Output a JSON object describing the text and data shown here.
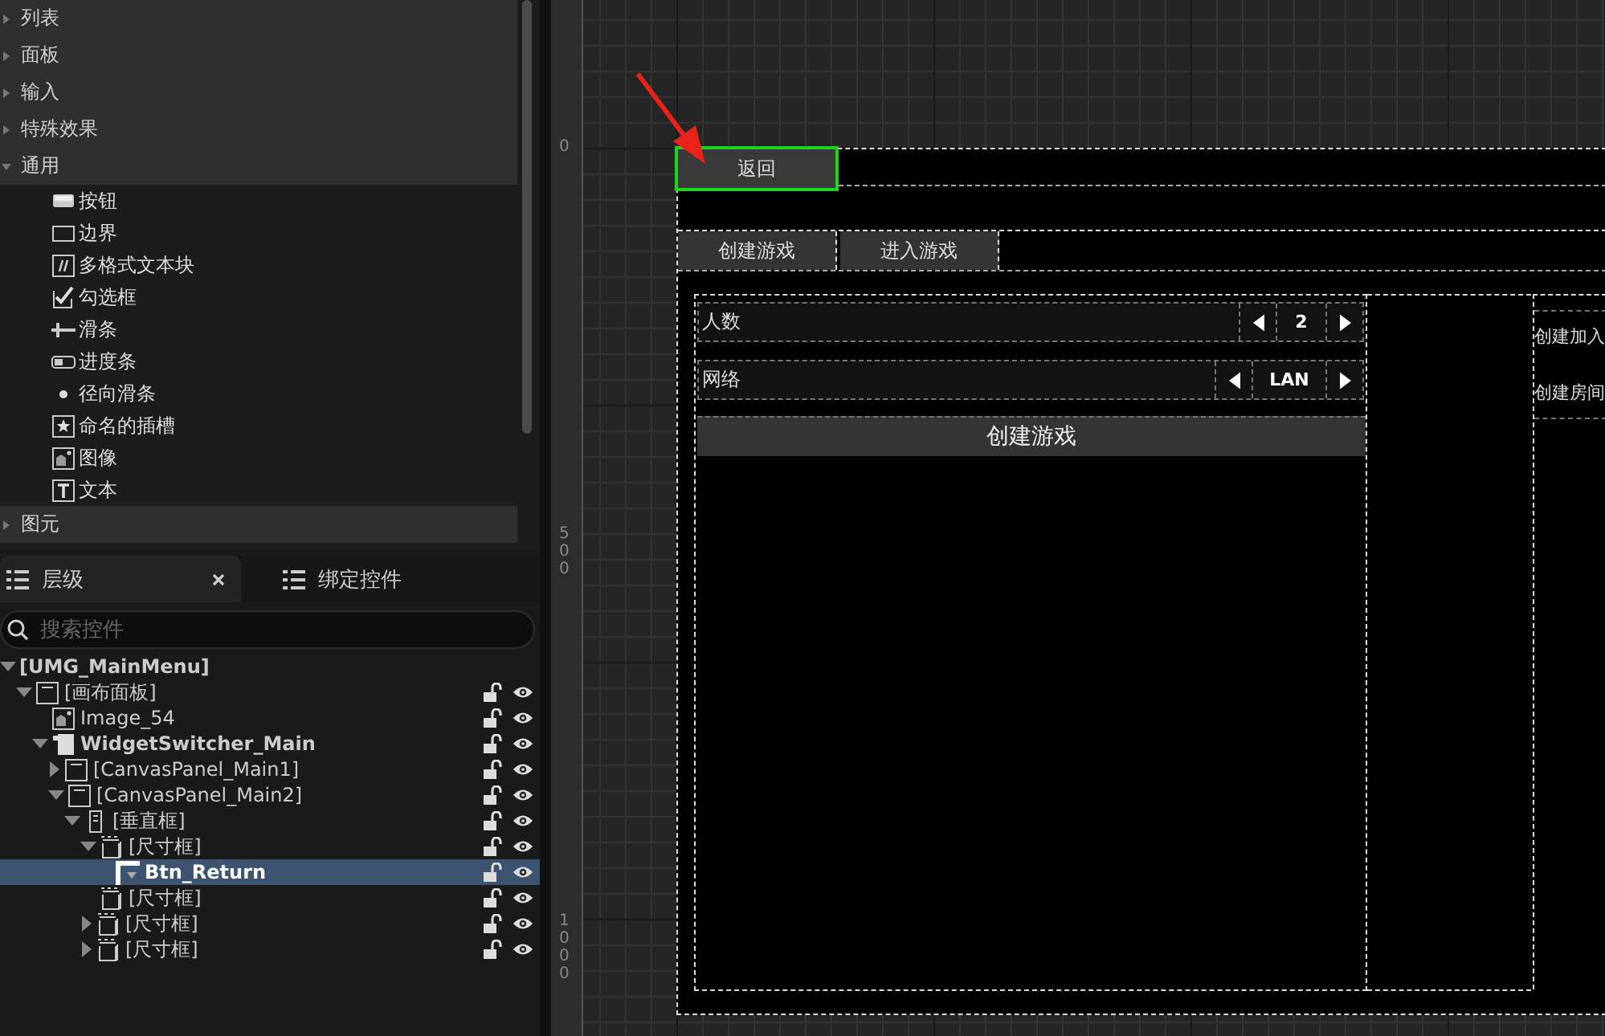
{
  "palette": {
    "categories": [
      {
        "label": "列表",
        "expanded": false
      },
      {
        "label": "面板",
        "expanded": false
      },
      {
        "label": "输入",
        "expanded": false
      },
      {
        "label": "特殊效果",
        "expanded": false
      },
      {
        "label": "通用",
        "expanded": true,
        "items": [
          {
            "label": "按钮",
            "kind": "button"
          },
          {
            "label": "边界",
            "kind": "border"
          },
          {
            "label": "多格式文本块",
            "kind": "richtext"
          },
          {
            "label": "勾选框",
            "kind": "checkbox"
          },
          {
            "label": "滑条",
            "kind": "slider"
          },
          {
            "label": "进度条",
            "kind": "progress"
          },
          {
            "label": "径向滑条",
            "kind": "radial"
          },
          {
            "label": "命名的插槽",
            "kind": "slot"
          },
          {
            "label": "图像",
            "kind": "image"
          },
          {
            "label": "文本",
            "kind": "text"
          }
        ]
      },
      {
        "label": "图元",
        "expanded": false
      }
    ]
  },
  "hierarchy": {
    "tabs": [
      {
        "label": "层级",
        "selected": true,
        "closable": true
      },
      {
        "label": "绑定控件",
        "selected": false,
        "closable": false
      }
    ],
    "search": {
      "placeholder": "搜索控件"
    },
    "tree": [
      {
        "label": "[UMG_MainMenu]",
        "bold": true,
        "expanded": true,
        "selected": false,
        "children": [
          {
            "label": "[画布面板]",
            "kind": "canvas",
            "expanded": true,
            "selected": false,
            "children": [
              {
                "label": "Image_54",
                "kind": "image",
                "selected": false
              },
              {
                "label": "WidgetSwitcher_Main",
                "kind": "switcher",
                "bold": true,
                "expanded": true,
                "selected": false,
                "children": [
                  {
                    "label": "[CanvasPanel_Main1]",
                    "kind": "canvas",
                    "expanded": false,
                    "selected": false
                  },
                  {
                    "label": "[CanvasPanel_Main2]",
                    "kind": "canvas",
                    "expanded": true,
                    "selected": false,
                    "children": [
                      {
                        "label": "[垂直框]",
                        "kind": "vbox",
                        "expanded": true,
                        "selected": false,
                        "children": [
                          {
                            "label": "[尺寸框]",
                            "kind": "sizebox",
                            "expanded": true,
                            "selected": false,
                            "children": [
                              {
                                "label": "Btn_Return",
                                "kind": "button",
                                "bold": true,
                                "selected": true
                              }
                            ]
                          },
                          {
                            "label": "[尺寸框]",
                            "kind": "sizebox",
                            "selected": false
                          },
                          {
                            "label": "[尺寸框]",
                            "kind": "sizebox",
                            "expanded": false,
                            "selected": false
                          },
                          {
                            "label": "[尺寸框]",
                            "kind": "sizebox",
                            "expanded": false,
                            "selected": false
                          }
                        ]
                      }
                    ]
                  }
                ]
              }
            ]
          }
        ]
      }
    ]
  },
  "designer": {
    "ruler": [
      "0",
      "500",
      "1000"
    ],
    "return_button": {
      "label": "返回",
      "selected": true
    },
    "tabs": [
      {
        "label": "创建游戏"
      },
      {
        "label": "进入游戏"
      }
    ],
    "rows": [
      {
        "label": "人数",
        "value": "2"
      },
      {
        "label": "网络",
        "value": "LAN"
      }
    ],
    "create_button": "创建游戏",
    "side_texts": [
      "创建加入",
      "创建房间"
    ]
  }
}
